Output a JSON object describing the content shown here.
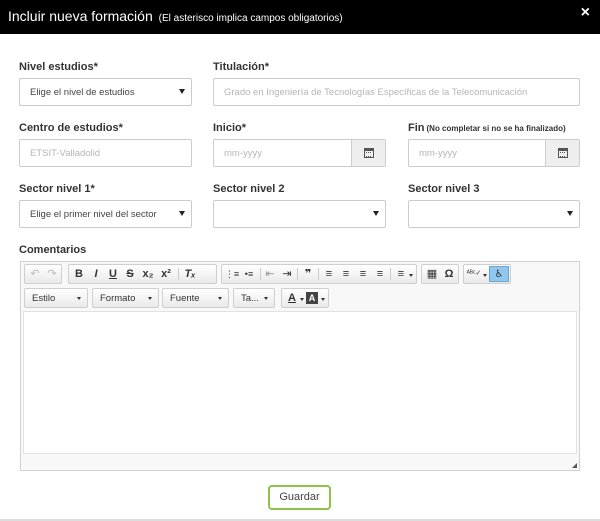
{
  "modal": {
    "title": "Incluir nueva formación",
    "note": "(El asterisco implica campos obligatorios)",
    "close_icon": "×"
  },
  "form": {
    "nivel_estudios": {
      "label": "Nivel estudios*",
      "value": "Elige el nivel de estudios"
    },
    "titulacion": {
      "label": "Titulación*",
      "placeholder": "Grado en Ingeniería de Tecnologías Específicas de la Telecomunicación"
    },
    "centro": {
      "label": "Centro de estudios*",
      "placeholder": "ETSIT-Valladolid"
    },
    "inicio": {
      "label": "Inicio*",
      "placeholder": "mm-yyyy",
      "icon": "calendar-icon"
    },
    "fin": {
      "label": "Fin",
      "note": "(No completar si no se ha finalizado)",
      "placeholder": "mm-yyyy",
      "icon": "calendar-icon"
    },
    "sector1": {
      "label": "Sector nivel 1*",
      "value": "Elige el primer nivel del sector"
    },
    "sector2": {
      "label": "Sector nivel 2",
      "value": ""
    },
    "sector3": {
      "label": "Sector nivel 3",
      "value": ""
    },
    "comentarios": {
      "label": "Comentarios"
    }
  },
  "editor": {
    "toolbar1": {
      "undo": "↶",
      "redo": "↷",
      "bold": "B",
      "italic": "I",
      "underline": "U",
      "strike": "S",
      "subscript": "x₂",
      "superscript": "x²",
      "remove_format": "Tₓ",
      "numbered_list": "⋮≡",
      "bulleted_list": "•≡",
      "outdent": "⇤",
      "indent": "⇥",
      "blockquote": "❞",
      "align_left": "≡",
      "align_center": "≡",
      "align_right": "≡",
      "justify": "≡",
      "direction": "≡",
      "table": "▦",
      "special_char": "Ω",
      "spellcheck": "ᴬᴮᶜ✓",
      "accessibility": "♿"
    },
    "toolbar2": {
      "style": "Estilo",
      "format": "Formato",
      "font": "Fuente",
      "size": "Ta...",
      "text_color": "A",
      "bg_color": "A"
    }
  },
  "actions": {
    "save": "Guardar"
  }
}
